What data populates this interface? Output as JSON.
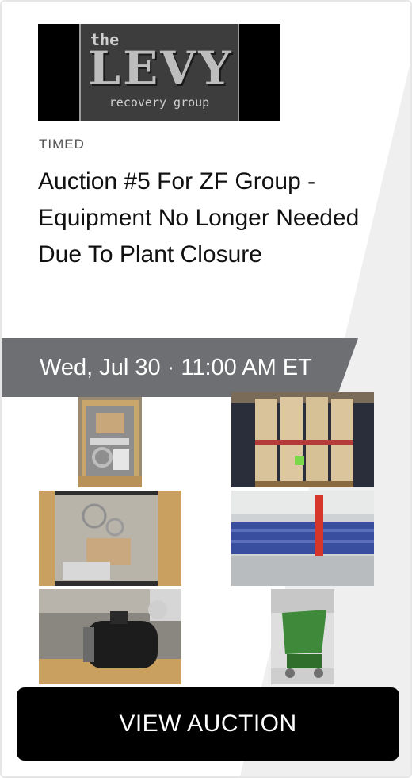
{
  "logo": {
    "top": "the",
    "main": "LEVY",
    "sub": "recovery group"
  },
  "auction": {
    "type": "TIMED",
    "title": "Auction #5 For ZF Group - Equipment No Longer Needed Due To Plant Closure",
    "date": "Wed, Jul 30 · 11:00 AM ET"
  },
  "photos": [
    {
      "name": "crate-parts-photo",
      "subject": "wooden crate with parts"
    },
    {
      "name": "boxed-shafts-photo",
      "subject": "long boxes on pallet"
    },
    {
      "name": "crate-cables-photo",
      "subject": "crate with cables and bags"
    },
    {
      "name": "warehouse-racks-photo",
      "subject": "blue storage racks in warehouse"
    },
    {
      "name": "electric-motor-photo",
      "subject": "electric motor on pallet"
    },
    {
      "name": "green-hopper-photo",
      "subject": "green dump hopper"
    }
  ],
  "cta": {
    "label": "VIEW AUCTION"
  },
  "colors": {
    "banner": "#6e6f72",
    "button": "#000000",
    "slant": "#efefef"
  }
}
